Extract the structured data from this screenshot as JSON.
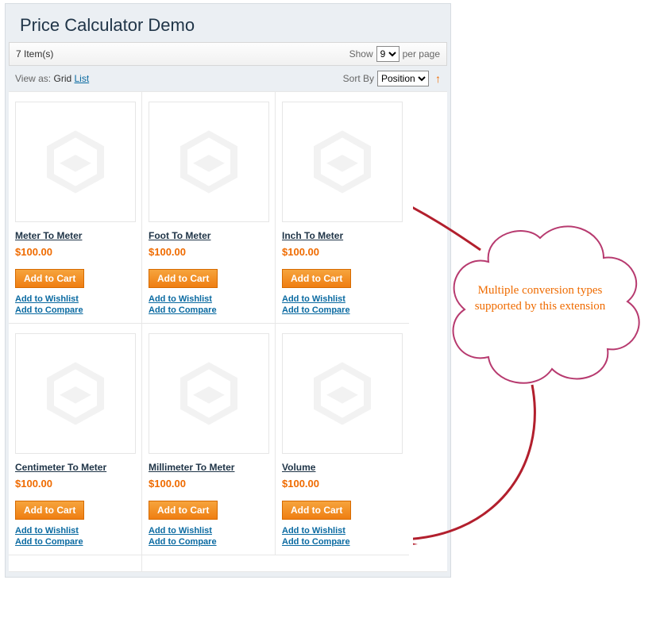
{
  "page_title": "Price Calculator Demo",
  "toolbar": {
    "item_count_label": "7 Item(s)",
    "show_label": "Show",
    "show_value": "9",
    "per_page_label": "per page"
  },
  "viewbar": {
    "view_as_label": "View as:",
    "grid_label": "Grid",
    "list_label": "List",
    "sort_by_label": "Sort By",
    "sort_value": "Position"
  },
  "labels": {
    "add_to_cart": "Add to Cart",
    "add_to_wishlist": "Add to Wishlist",
    "add_to_compare": "Add to Compare"
  },
  "products": [
    {
      "name": "Meter To Meter",
      "price": "$100.00"
    },
    {
      "name": "Foot To Meter",
      "price": "$100.00"
    },
    {
      "name": "Inch To Meter",
      "price": "$100.00"
    },
    {
      "name": "Centimeter To Meter",
      "price": "$100.00"
    },
    {
      "name": "Millimeter To Meter",
      "price": "$100.00"
    },
    {
      "name": "Volume",
      "price": "$100.00"
    }
  ],
  "annotation": "Multiple conversion types supported by this extension"
}
